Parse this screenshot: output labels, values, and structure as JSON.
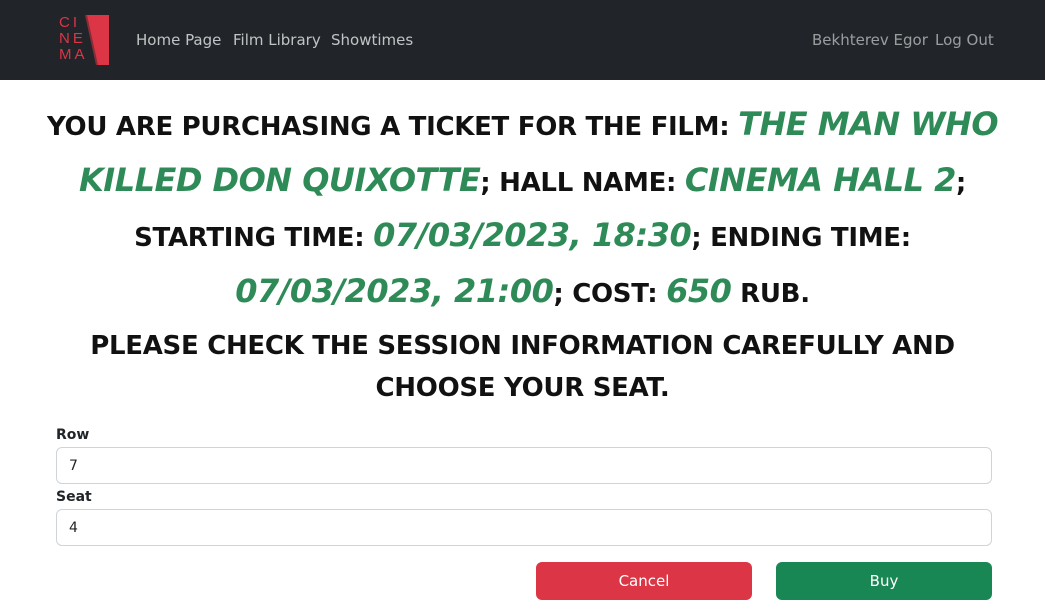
{
  "navbar": {
    "logo_text": "CI\nNE\nMA",
    "brand_color": "#dc3545",
    "links": [
      {
        "label": "Home Page"
      },
      {
        "label": "Film Library"
      },
      {
        "label": "Showtimes"
      }
    ],
    "user_name": "Bekhterev Egor",
    "logout_label": "Log Out"
  },
  "purchase": {
    "intro": "You are purchasing a ticket for the film: ",
    "film": "The Man Who Killed Don Quixotte",
    "hall_label": "; hall name: ",
    "hall": "Cinema Hall 2",
    "start_label": "; starting time: ",
    "start": "07/03/2023, 18:30",
    "end_label": "; ending time: ",
    "end": "07/03/2023, 21:00",
    "cost_label": "; cost: ",
    "cost": "650",
    "currency": " rub.",
    "highlight_color": "#2e8b57"
  },
  "notice": "Please check the session information carefully and choose your seat.",
  "form": {
    "row_label": "Row",
    "row_value": "7",
    "seat_label": "Seat",
    "seat_value": "4"
  },
  "buttons": {
    "cancel": "Cancel",
    "buy": "Buy",
    "cancel_color": "#dc3545",
    "buy_color": "#198754"
  }
}
